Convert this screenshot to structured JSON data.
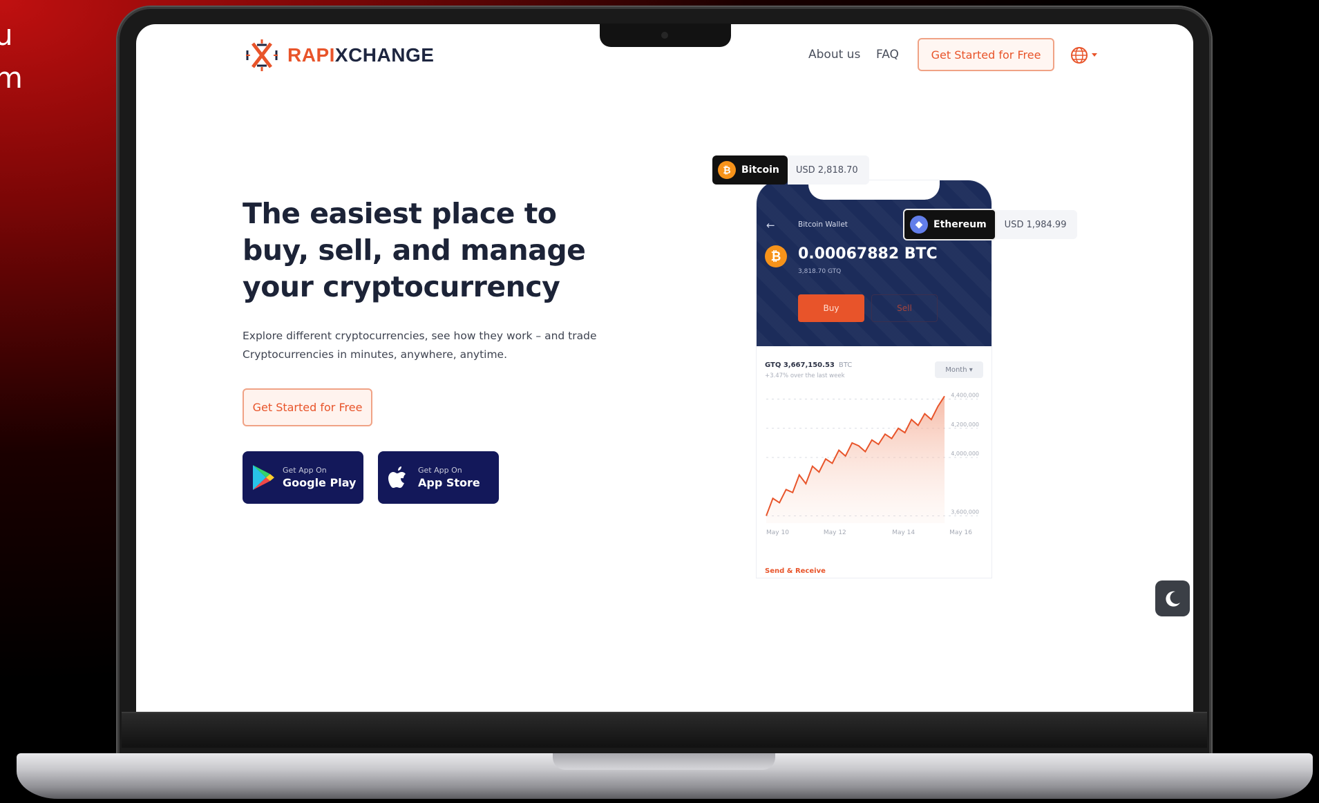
{
  "side_text": [
    "u",
    "m"
  ],
  "brand": {
    "part1": "RAPI",
    "part2": "XCHANGE"
  },
  "nav": {
    "links": [
      "About us",
      "FAQ"
    ],
    "cta_label": "Get Started for Free"
  },
  "hero": {
    "title": "The easiest place to buy, sell, and manage your cryptocurrency",
    "description": "Explore different cryptocurrencies, see how they work – and trade Cryptocurrencies in minutes, anywhere, anytime.",
    "cta_label": "Get Started for Free"
  },
  "stores": [
    {
      "small": "Get App On",
      "big": "Google Play"
    },
    {
      "small": "Get App On",
      "big": "App Store"
    }
  ],
  "tags": {
    "bitcoin": {
      "name": "Bitcoin",
      "price": "USD 2,818.70"
    },
    "ethereum": {
      "name": "Ethereum",
      "price": "USD 1,984.99"
    }
  },
  "phone": {
    "back": "←",
    "wallet_label": "Bitcoin Wallet",
    "balance": "0.00067882 BTC",
    "balance_sub": "3,818.70 GTQ",
    "buy_label": "Buy",
    "sell_label": "Sell",
    "price": "GTQ 3,667,150.53",
    "price_unit": "BTC",
    "change": "+3.47% over the last week",
    "period": "Month ▾",
    "send_label": "Send & Receive"
  },
  "chart_data": {
    "type": "area",
    "x": [
      "May 10",
      "May 12",
      "May 14",
      "May 16"
    ],
    "y_ticks": [
      "3,600,000",
      "4,000,000",
      "4,200,000",
      "4,400,000"
    ],
    "series": [
      {
        "values": [
          3600000,
          3720000,
          3690000,
          3780000,
          3760000,
          3880000,
          3820000,
          3940000,
          3900000,
          3990000,
          3960000,
          4050000,
          4010000,
          4100000,
          4080000,
          4040000,
          4120000,
          4090000,
          4160000,
          4130000,
          4200000,
          4170000,
          4260000,
          4220000,
          4300000,
          4260000,
          4350000,
          4420000
        ]
      }
    ],
    "ylim": [
      3550000,
      4450000
    ],
    "color": "#e8542a"
  },
  "colors": {
    "accent": "#e8542a",
    "navy": "#1c2c5a",
    "store_bg": "#13185a",
    "bitcoin": "#f7931a",
    "ethereum": "#627eea"
  }
}
